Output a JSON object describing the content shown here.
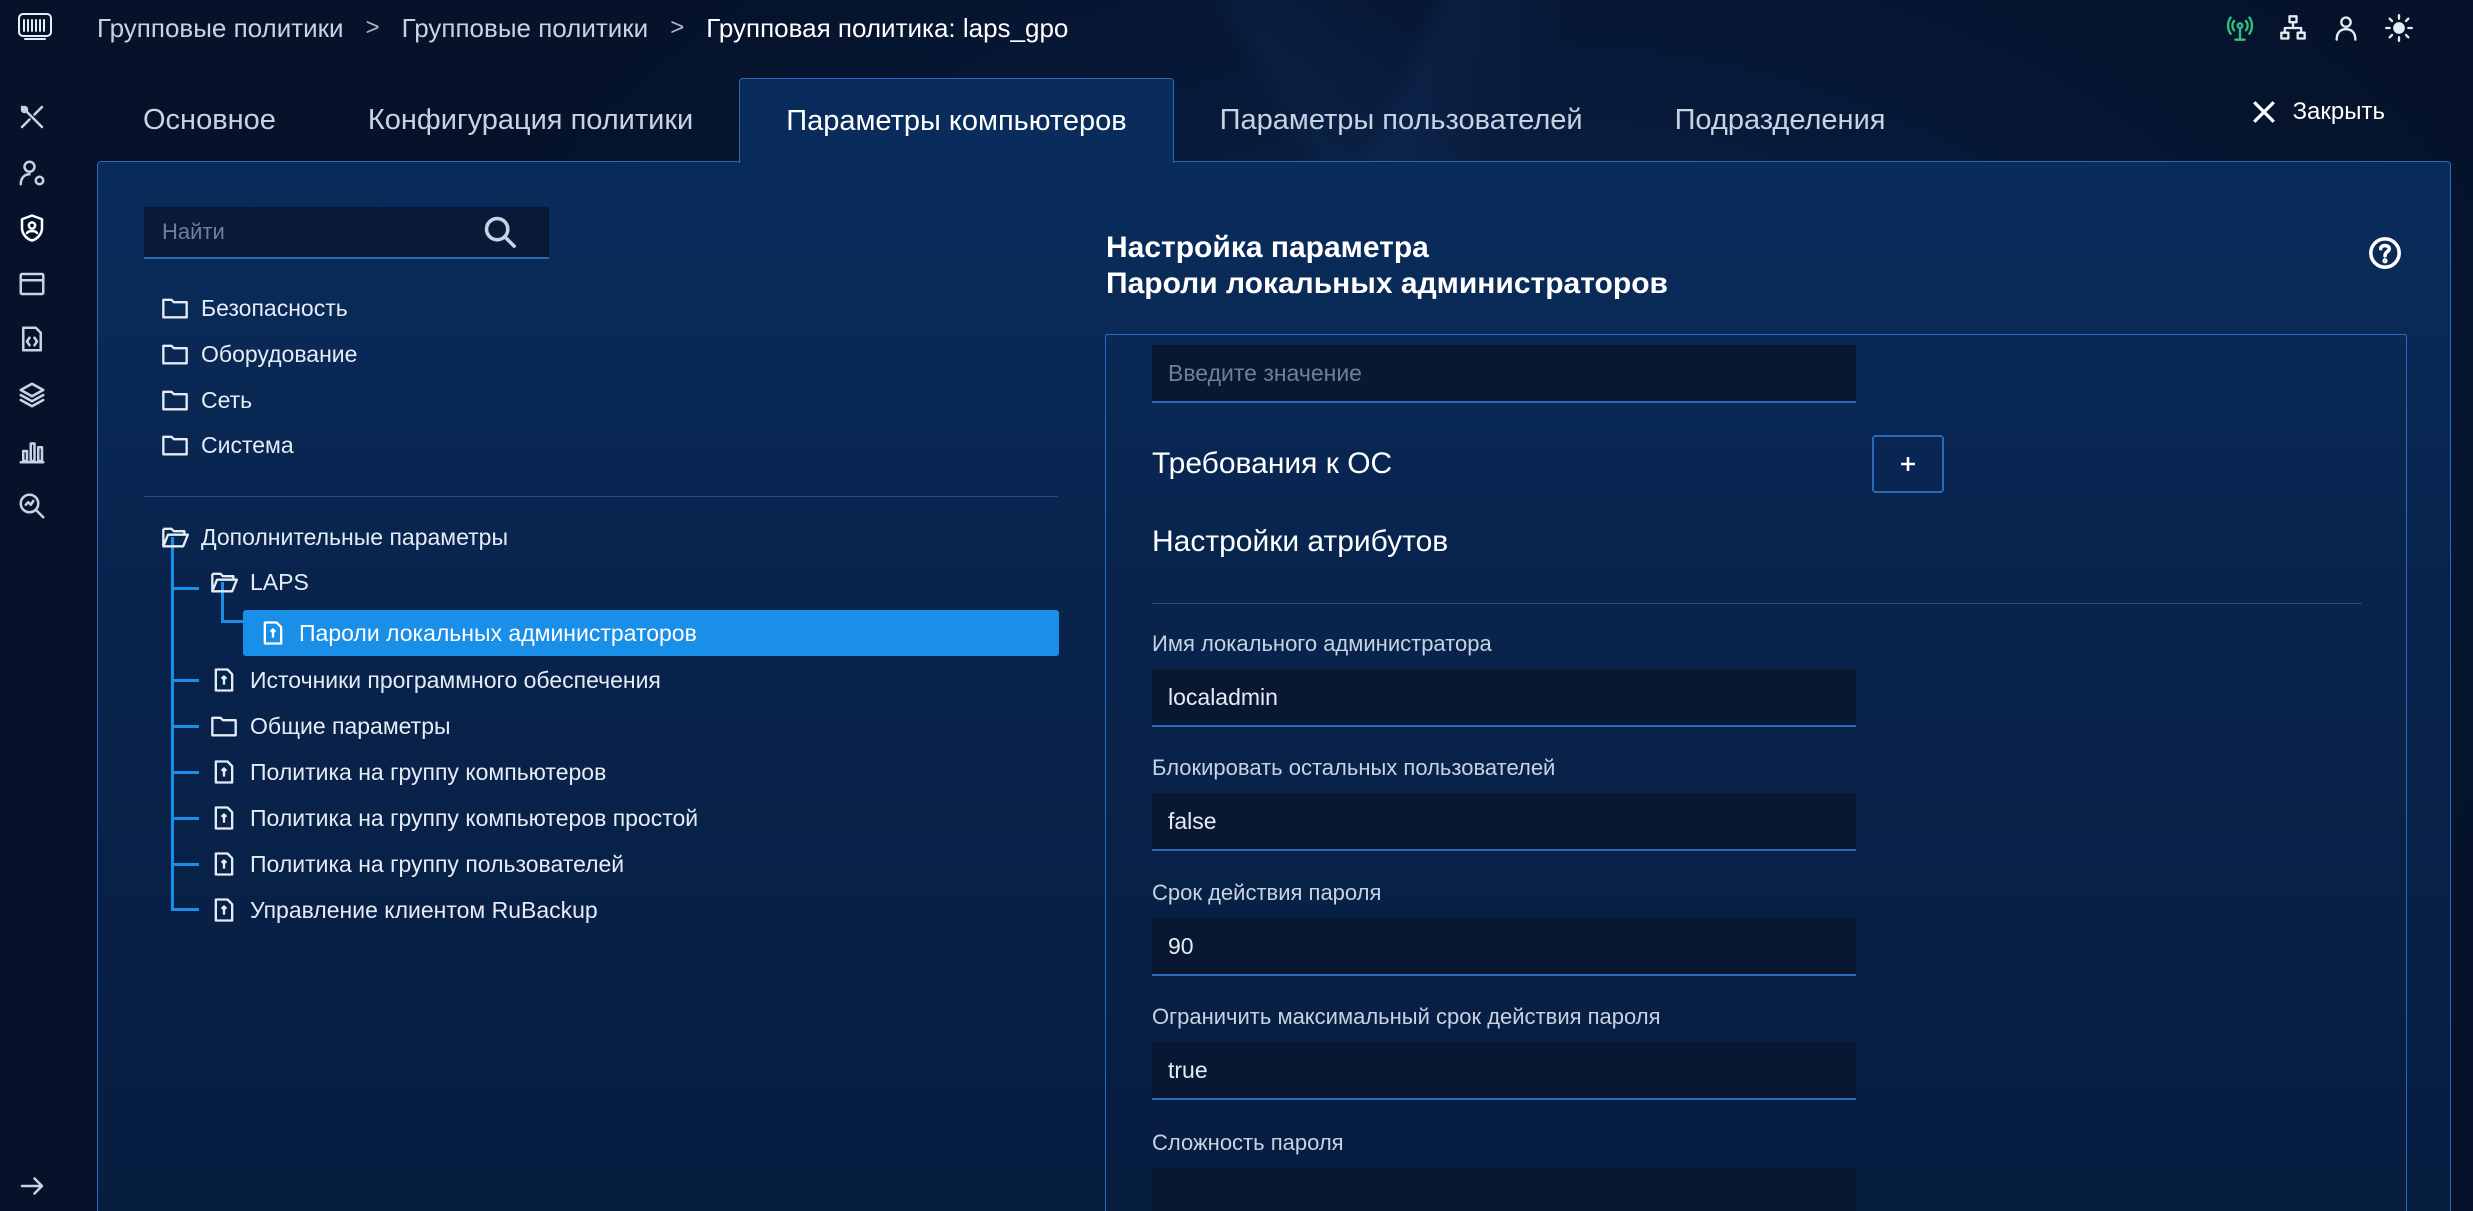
{
  "breadcrumb": {
    "items": [
      "Групповые политики",
      "Групповые политики"
    ],
    "current": "Групповая политика: laps_gpo",
    "separator": ">"
  },
  "rail": {
    "icons": [
      "logo-icon",
      "tools-icon",
      "user-settings-icon",
      "shield-user-icon",
      "window-icon",
      "code-file-icon",
      "layers-icon",
      "chart-icon",
      "search-zoom-icon",
      "arrow-right-icon"
    ]
  },
  "top_icons": [
    "signal-icon",
    "network-icon",
    "user-icon",
    "sun-icon"
  ],
  "tabs": [
    {
      "label": "Основное"
    },
    {
      "label": "Конфигурация политики"
    },
    {
      "label": "Параметры компьютеров"
    },
    {
      "label": "Параметры пользователей"
    },
    {
      "label": "Подразделения"
    }
  ],
  "active_tab": "Параметры компьютеров",
  "close_label": "Закрыть",
  "search": {
    "placeholder": "Найти",
    "value": ""
  },
  "tree": {
    "top": [
      {
        "label": "Безопасность"
      },
      {
        "label": "Оборудование"
      },
      {
        "label": "Сеть"
      },
      {
        "label": "Система"
      }
    ],
    "extra": {
      "label": "Дополнительные параметры",
      "laps": "LAPS",
      "selected": "Пароли локальных администраторов",
      "children": [
        "Источники программного обеспечения",
        "Общие параметры",
        "Политика на группу компьютеров",
        "Политика на группу компьютеров простой",
        "Политика на группу пользователей",
        "Управление клиентом RuBackup"
      ]
    }
  },
  "settings": {
    "title_line1": "Настройка параметра",
    "title_line2": "Пароли локальных администраторов",
    "top_input_placeholder": "Введите значение",
    "os_requirements": "Требования к ОС",
    "attributes_heading": "Настройки атрибутов",
    "fields": [
      {
        "label": "Имя локального администратора",
        "value": "localadmin"
      },
      {
        "label": "Блокировать остальных пользователей",
        "value": "false"
      },
      {
        "label": "Срок действия пароля",
        "value": "90"
      },
      {
        "label": "Ограничить максимальный срок действия пароля",
        "value": "true"
      },
      {
        "label": "Сложность пароля",
        "value": ""
      }
    ]
  },
  "colors": {
    "accent": "#1a8fe8",
    "border": "#2a6ab8",
    "background": "#05122a",
    "status_green": "#2ec27e"
  }
}
